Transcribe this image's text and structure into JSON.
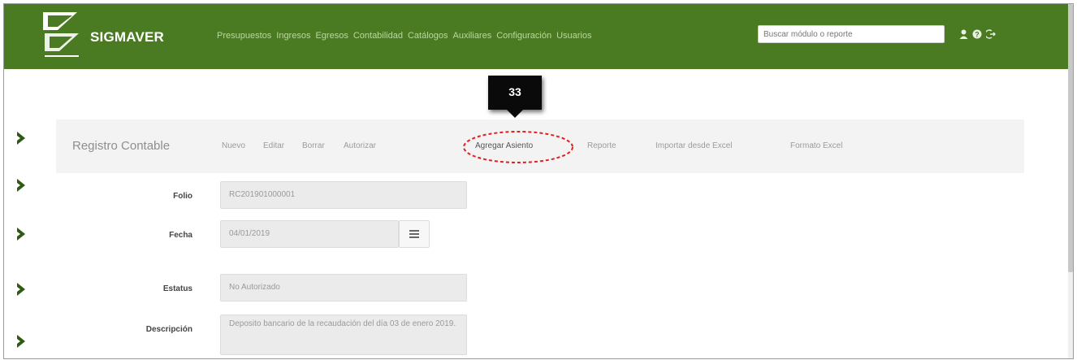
{
  "app": {
    "brand": "SIGMAVER"
  },
  "nav": {
    "items": [
      "Presupuestos",
      "Ingresos",
      "Egresos",
      "Contabilidad",
      "Catálogos",
      "Auxiliares",
      "Configuración",
      "Usuarios"
    ],
    "search_placeholder": "Buscar módulo o reporte",
    "icons": [
      "user-icon",
      "help-icon",
      "logout-icon"
    ]
  },
  "callout": {
    "number": "33"
  },
  "toolbar": {
    "title": "Registro Contable",
    "items": [
      "Nuevo",
      "Editar",
      "Borrar",
      "Autorizar",
      "Agregar Asiento",
      "Reporte",
      "Importar desde Excel",
      "Formato Excel"
    ],
    "active": "Agregar Asiento"
  },
  "form": {
    "folio": {
      "label": "Folio",
      "value": "RC201901000001"
    },
    "fecha": {
      "label": "Fecha",
      "value": "04/01/2019"
    },
    "estatus": {
      "label": "Estatus",
      "value": "No Autorizado"
    },
    "descripcion": {
      "label": "Descripción",
      "value": "Deposito bancario de la recaudación del día 03 de enero 2019."
    }
  },
  "colors": {
    "navbar": "#4a7a22",
    "callout_ring": "#e02020",
    "chevron": "#2f5a16"
  }
}
